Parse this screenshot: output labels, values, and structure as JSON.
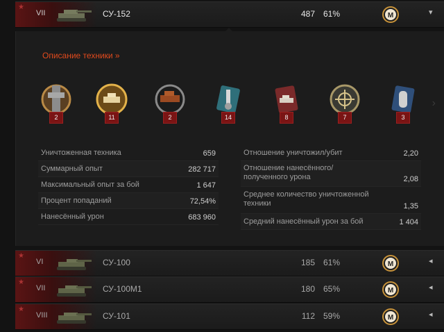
{
  "rows": [
    {
      "tier": "VII",
      "name": "СУ-152",
      "battles": "487",
      "winrate": "61%",
      "mastery": "M",
      "arrow": "▾"
    },
    {
      "tier": "VI",
      "name": "СУ-100",
      "battles": "185",
      "winrate": "61%",
      "mastery": "M",
      "arrow": "◂"
    },
    {
      "tier": "VII",
      "name": "СУ-100М1",
      "battles": "180",
      "winrate": "65%",
      "mastery": "M",
      "arrow": "◂"
    },
    {
      "tier": "VIII",
      "name": "СУ-101",
      "battles": "112",
      "winrate": "59%",
      "mastery": "M",
      "arrow": "◂"
    }
  ],
  "details": {
    "link": "Описание техники »",
    "medals": [
      {
        "icon": "tank-mastery-badge-icon",
        "count": "2"
      },
      {
        "icon": "golden-laurel-tank-icon",
        "count": "11"
      },
      {
        "icon": "tank-wreath-badge-icon",
        "count": "2"
      },
      {
        "icon": "blue-sword-medal-icon",
        "count": "14"
      },
      {
        "icon": "red-tank-medal-icon",
        "count": "8"
      },
      {
        "icon": "crosshair-laurel-icon",
        "count": "7"
      },
      {
        "icon": "blue-shell-medal-icon",
        "count": "3"
      }
    ],
    "stats_left": [
      {
        "label": "Уничтоженная техника",
        "value": "659"
      },
      {
        "label": "Суммарный опыт",
        "value": "282 717"
      },
      {
        "label": "Максимальный опыт за бой",
        "value": "1 647"
      },
      {
        "label": "Процент попаданий",
        "value": "72,54%"
      },
      {
        "label": "Нанесённый урон",
        "value": "683 960"
      }
    ],
    "stats_right": [
      {
        "label": "Отношение уничтожил/убит",
        "value": "2,20"
      },
      {
        "label": "Отношение нанесённого/полученного урона",
        "value": "2,08"
      },
      {
        "label": "Среднее количество уничтоженной техники",
        "value": "1,35"
      },
      {
        "label": "Средний нанесённый урон за бой",
        "value": "1 404"
      }
    ]
  },
  "colors": {
    "accent_link": "#e24a1c",
    "count_badge": "#7a1414",
    "flag_red": "#5a1414"
  }
}
